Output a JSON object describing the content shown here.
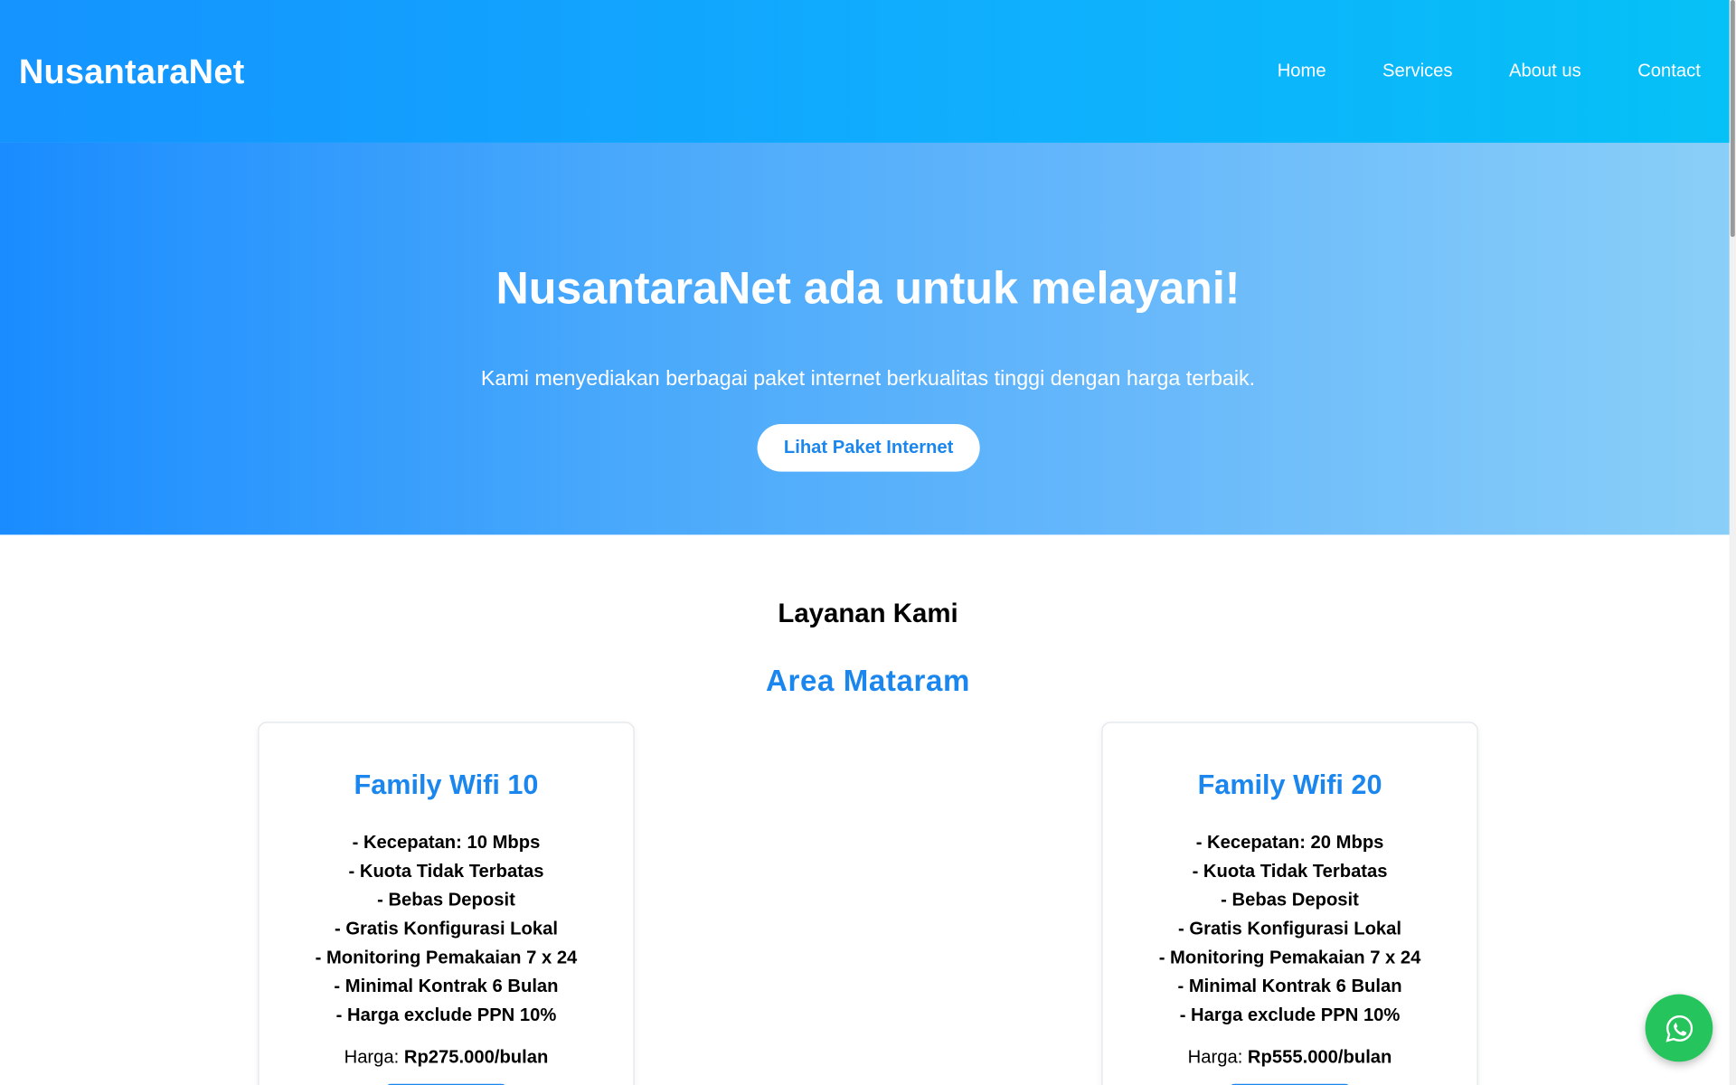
{
  "nav": {
    "brand": "NusantaraNet",
    "links": [
      "Home",
      "Services",
      "About us",
      "Contact"
    ]
  },
  "hero": {
    "title": "NusantaraNet ada untuk melayani!",
    "subtitle": "Kami menyediakan berbagai paket internet berkualitas tinggi dengan harga terbaik.",
    "button": "Lihat Paket Internet"
  },
  "services": {
    "heading": "Layanan Kami",
    "area": "Area Mataram",
    "cards": [
      {
        "title": "Family Wifi 10",
        "features": [
          "- Kecepatan: 10 Mbps",
          "- Kuota Tidak Terbatas",
          "- Bebas Deposit",
          "- Gratis Konfigurasi Lokal",
          "- Monitoring Pemakaian 7 x 24",
          "- Minimal Kontrak 6 Bulan",
          "- Harga exclude PPN 10%"
        ],
        "price_label": "Harga: ",
        "price_value": "Rp275.000/bulan"
      },
      {
        "title": "Family Wifi 20",
        "features": [
          "- Kecepatan: 20 Mbps",
          "- Kuota Tidak Terbatas",
          "- Bebas Deposit",
          "- Gratis Konfigurasi Lokal",
          "- Monitoring Pemakaian 7 x 24",
          "- Minimal Kontrak 6 Bulan",
          "- Harga exclude PPN 10%"
        ],
        "price_label": "Harga: ",
        "price_value": "Rp555.000/bulan"
      }
    ]
  },
  "floating": {
    "icon": "whatsapp-icon",
    "color": "#25c45c"
  },
  "colors": {
    "accent": "#1a86ee",
    "nav_start": "#1593ff",
    "nav_end": "#05c1f6"
  }
}
